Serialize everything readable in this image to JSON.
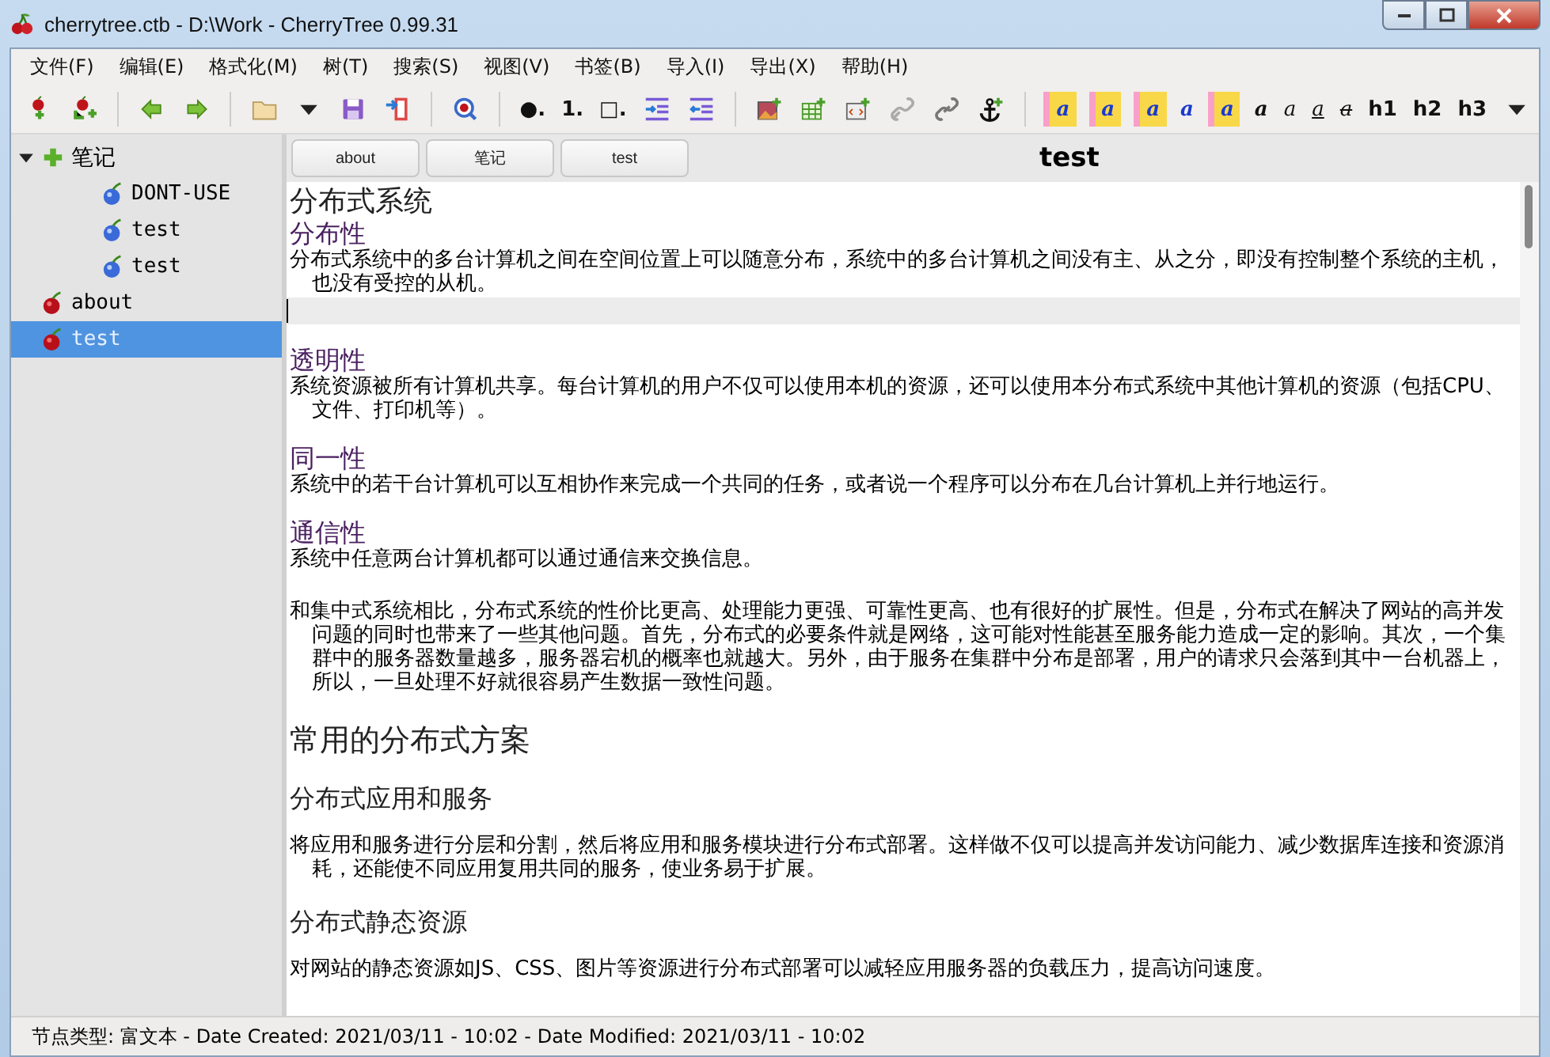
{
  "window": {
    "title": "cherrytree.ctb - D:\\Work - CherryTree 0.99.31"
  },
  "menu": [
    "文件(F)",
    "编辑(E)",
    "格式化(M)",
    "树(T)",
    "搜索(S)",
    "视图(V)",
    "书签(B)",
    "导入(I)",
    "导出(X)",
    "帮助(H)"
  ],
  "toolbar": [
    [
      {
        "kind": "cherry-add"
      },
      {
        "kind": "cherry-add-child"
      }
    ],
    [
      {
        "kind": "arrow-left"
      },
      {
        "kind": "arrow-right"
      }
    ],
    [
      {
        "kind": "folder"
      },
      {
        "kind": "caret"
      },
      {
        "kind": "save"
      },
      {
        "kind": "export"
      }
    ],
    [
      {
        "kind": "search"
      }
    ],
    [
      {
        "kind": "text",
        "label": "●."
      },
      {
        "kind": "text",
        "label": "1."
      },
      {
        "kind": "text",
        "label": "□."
      },
      {
        "kind": "indent"
      },
      {
        "kind": "unindent"
      }
    ],
    [
      {
        "kind": "image"
      },
      {
        "kind": "table"
      },
      {
        "kind": "codebox"
      },
      {
        "kind": "link"
      },
      {
        "kind": "link-dark"
      },
      {
        "kind": "anchor"
      }
    ],
    [
      {
        "kind": "fg",
        "label": "a"
      },
      {
        "kind": "fg",
        "label": "a"
      },
      {
        "kind": "fg",
        "label": "a"
      },
      {
        "kind": "fg-plain",
        "label": "a"
      },
      {
        "kind": "fg",
        "label": "a"
      },
      {
        "kind": "bold",
        "label": "a"
      },
      {
        "kind": "italic",
        "label": "a"
      },
      {
        "kind": "underline",
        "label": "a"
      },
      {
        "kind": "strike",
        "label": "a"
      },
      {
        "kind": "text",
        "label": "h1"
      },
      {
        "kind": "text",
        "label": "h2"
      },
      {
        "kind": "text",
        "label": "h3"
      },
      {
        "kind": "caret"
      }
    ]
  ],
  "tree": [
    {
      "label": "笔记",
      "kind": "plus",
      "expanded": true,
      "selected": false,
      "children": [
        {
          "label": "DONT-USE",
          "kind": "blue-cherry",
          "selected": false
        },
        {
          "label": "test",
          "kind": "blue-cherry",
          "selected": false
        },
        {
          "label": "test",
          "kind": "blue-cherry",
          "selected": false
        }
      ]
    },
    {
      "label": "about",
      "kind": "cherry",
      "selected": false
    },
    {
      "label": "test",
      "kind": "cherry",
      "selected": true
    }
  ],
  "tabs": [
    "about",
    "笔记",
    "test"
  ],
  "node_title": "test",
  "content": [
    {
      "kind": "h1",
      "text": "分布式系统"
    },
    {
      "kind": "h2",
      "text": "分布性"
    },
    {
      "kind": "para",
      "text": "分布式系统中的多台计算机之间在空间位置上可以随意分布，系统中的多台计算机之间没有主、从之分，即没有控制整个系统的主机，也没有受控的从机。"
    },
    {
      "kind": "cursor"
    },
    {
      "kind": "h2",
      "text": "透明性"
    },
    {
      "kind": "para",
      "text": "系统资源被所有计算机共享。每台计算机的用户不仅可以使用本机的资源，还可以使用本分布式系统中其他计算机的资源（包括CPU、文件、打印机等）。"
    },
    {
      "kind": "h2",
      "text": "同一性"
    },
    {
      "kind": "para",
      "text": "系统中的若干台计算机可以互相协作来完成一个共同的任务，或者说一个程序可以分布在几台计算机上并行地运行。"
    },
    {
      "kind": "h2",
      "text": "通信性"
    },
    {
      "kind": "para",
      "text": "系统中任意两台计算机都可以通过通信来交换信息。"
    },
    {
      "kind": "para",
      "text": "和集中式系统相比，分布式系统的性价比更高、处理能力更强、可靠性更高、也有很好的扩展性。但是，分布式在解决了网站的高并发问题的同时也带来了一些其他问题。首先，分布式的必要条件就是网络，这可能对性能甚至服务能力造成一定的影响。其次，一个集群中的服务器数量越多，服务器宕机的概率也就越大。另外，由于服务在集群中分布是部署，用户的请求只会落到其中一台机器上，所以，一旦处理不好就很容易产生数据一致性问题。"
    },
    {
      "kind": "h1",
      "text": "常用的分布式方案"
    },
    {
      "kind": "h3",
      "text": "分布式应用和服务"
    },
    {
      "kind": "para",
      "text": "将应用和服务进行分层和分割，然后将应用和服务模块进行分布式部署。这样做不仅可以提高并发访问能力、减少数据库连接和资源消耗，还能使不同应用复用共同的服务，使业务易于扩展。"
    },
    {
      "kind": "h3",
      "text": "分布式静态资源"
    },
    {
      "kind": "para",
      "text": "对网站的静态资源如JS、CSS、图片等资源进行分布式部署可以减轻应用服务器的负载压力，提高访问速度。"
    }
  ],
  "status_bar": "节点类型: 富文本  -  Date Created: 2021/03/11 - 10:02  -  Date Modified: 2021/03/11 - 10:02"
}
